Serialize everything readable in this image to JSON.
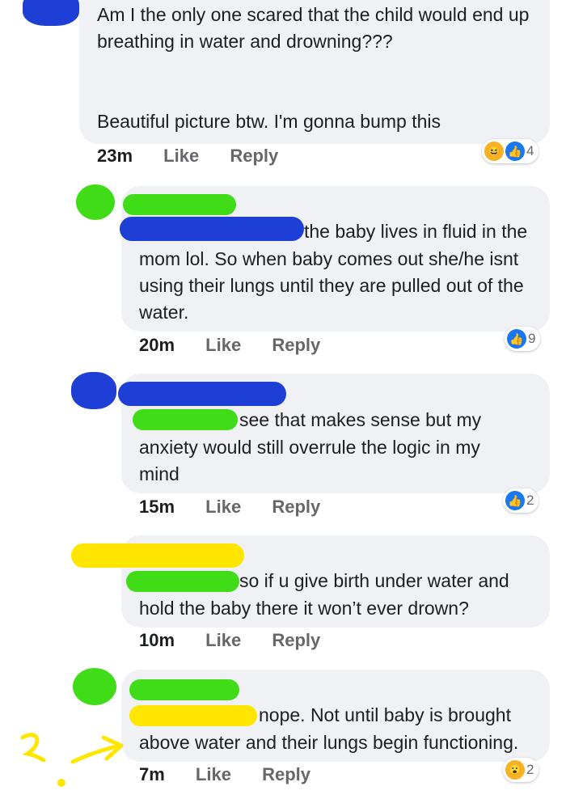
{
  "comments": [
    {
      "text": "Am I the only one scared that the child would end up breathing in water and drowning???\n\n\nBeautiful picture btw. I'm gonna bump this",
      "time": "23m",
      "like_label": "Like",
      "reply_label": "Reply",
      "reaction_count": "4",
      "reactions": [
        "haha-icon",
        "like-icon"
      ]
    },
    {
      "line1": "the baby lives in fluid in the",
      "text": "mom lol. So when baby comes out she/he isnt\nusing their lungs until they are pulled out of the\nwater.",
      "time": "20m",
      "like_label": "Like",
      "reply_label": "Reply",
      "reaction_count": "9",
      "reactions": [
        "like-icon"
      ]
    },
    {
      "line1": "see that makes sense but my",
      "text": "anxiety would still overrule the logic in my\nmind",
      "time": "15m",
      "like_label": "Like",
      "reply_label": "Reply",
      "reaction_count": "2",
      "reactions": [
        "like-icon"
      ]
    },
    {
      "line1": "so if u give birth under water and",
      "text": "hold the baby there it won’t ever drown?",
      "time": "10m",
      "like_label": "Like",
      "reply_label": "Reply"
    },
    {
      "line1": "nope. Not until baby is brought",
      "text": "above water and their lungs begin functioning.",
      "time": "7m",
      "like_label": "Like",
      "reply_label": "Reply",
      "reaction_count": "2",
      "reactions": [
        "wow-icon"
      ]
    }
  ],
  "colors": {
    "bubble": "#eff1f4",
    "redact_blue": "#1e3fd6",
    "redact_green": "#3fdc17",
    "redact_yellow": "#ffe600",
    "like_blue": "#1877f2"
  }
}
